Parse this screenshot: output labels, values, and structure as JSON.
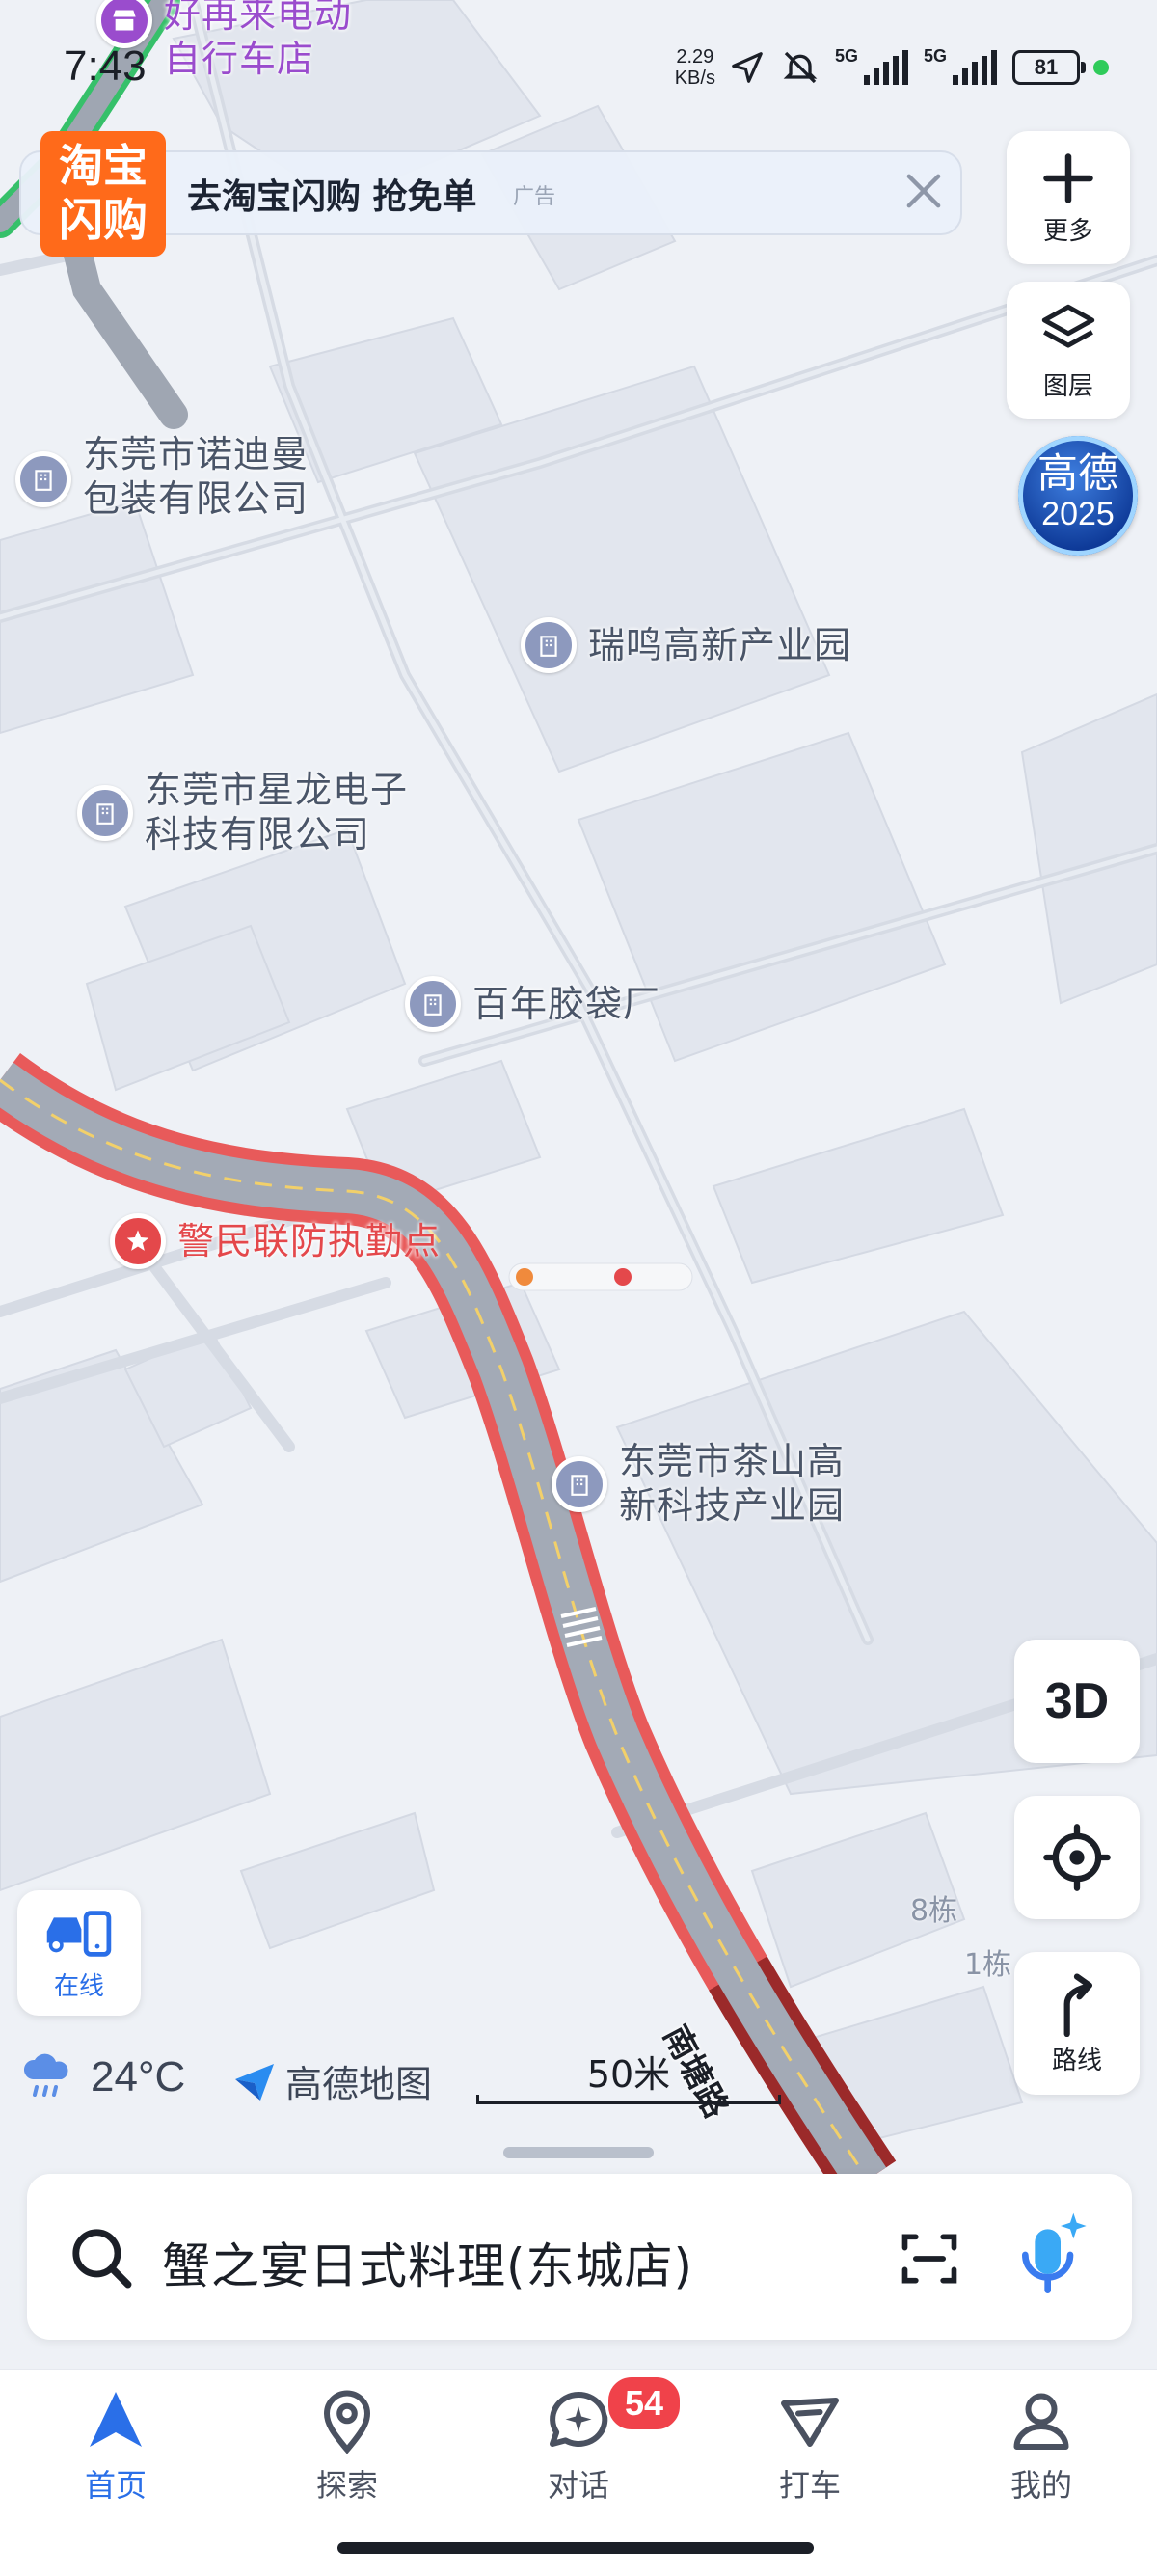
{
  "status_bar": {
    "time": "7:43",
    "net_speed_value": "2.29",
    "net_speed_unit": "KB/s",
    "sim1": "5G",
    "sim2": "5G",
    "battery": "81"
  },
  "ad_banner": {
    "logo_line1": "淘宝",
    "logo_line2": "闪购",
    "text": "去淘宝闪购 抢免单",
    "tag": "广告"
  },
  "controls": {
    "more_label": "更多",
    "layers_label": "图层",
    "badge_line1": "高德",
    "badge_line2": "2025",
    "mode_3d": "3D",
    "route_label": "路线",
    "online_label": "在线"
  },
  "map": {
    "pois": [
      {
        "name_line1": "好再来电动",
        "name_line2": "自行车店",
        "kind": "shop"
      },
      {
        "name_line1": "东莞市诺迪曼",
        "name_line2": "包装有限公司",
        "kind": "company"
      },
      {
        "name_line1": "瑞鸣高新产业园",
        "name_line2": "",
        "kind": "company"
      },
      {
        "name_line1": "东莞市星龙电子",
        "name_line2": "科技有限公司",
        "kind": "company"
      },
      {
        "name_line1": "百年胶袋厂",
        "name_line2": "",
        "kind": "company"
      },
      {
        "name_line1": "警民联防执勤点",
        "name_line2": "",
        "kind": "police"
      },
      {
        "name_line1": "东莞市茶山高",
        "name_line2": "新科技产业园",
        "kind": "company"
      }
    ],
    "building_labels": [
      "8栋",
      "1栋"
    ],
    "road_name": "南塘路",
    "road_traffic_colors": {
      "congested": "#e85a5a",
      "slow": "#f4c23a",
      "heavy": "#9b2a2a"
    }
  },
  "weather": {
    "icon": "rain-cloud-icon",
    "temperature": "24°C"
  },
  "map_brand": "高德地图",
  "scale_text": "50米",
  "search": {
    "query": "蟹之宴日式料理(东城店)"
  },
  "tabs": [
    {
      "label": "首页",
      "icon": "navigation-arrow-icon",
      "active": true
    },
    {
      "label": "探索",
      "icon": "location-pin-icon",
      "active": false
    },
    {
      "label": "对话",
      "icon": "chat-bubble-icon",
      "active": false,
      "badge": "54"
    },
    {
      "label": "打车",
      "icon": "taxi-arrow-icon",
      "active": false
    },
    {
      "label": "我的",
      "icon": "person-icon",
      "active": false
    }
  ],
  "colors": {
    "accent": "#2a6fe8",
    "map_background": "#eef1f6",
    "poi_pin": "#8d99be"
  }
}
